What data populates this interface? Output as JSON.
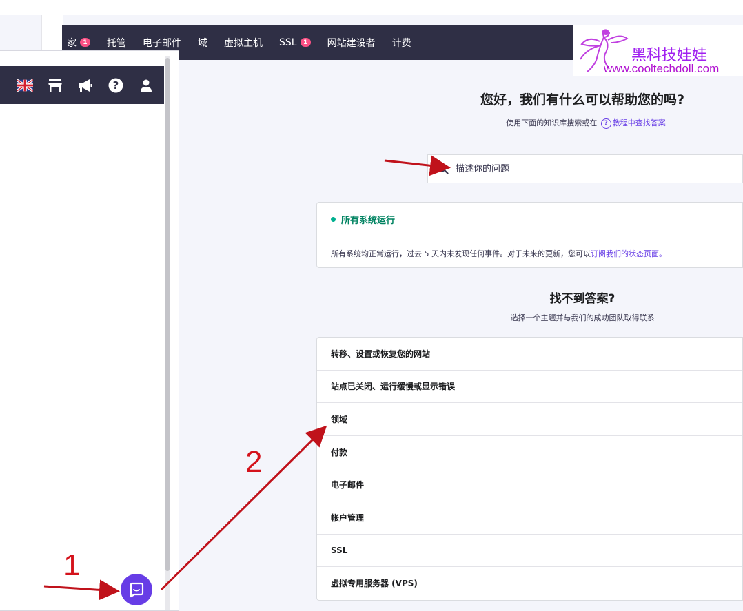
{
  "top_nav": {
    "items": [
      {
        "label": "家",
        "badge": "1"
      },
      {
        "label": "托管",
        "badge": ""
      },
      {
        "label": "电子邮件",
        "badge": ""
      },
      {
        "label": "域",
        "badge": ""
      },
      {
        "label": "虚拟主机",
        "badge": ""
      },
      {
        "label": "SSL",
        "badge": "1"
      },
      {
        "label": "网站建设者",
        "badge": ""
      },
      {
        "label": "计费",
        "badge": ""
      }
    ]
  },
  "watermark": {
    "text_cn": "黑科技娃娃",
    "url": "www.cooltechdoll.com"
  },
  "left_panel": {
    "toolbar_icons": [
      "uk-flag-icon",
      "store-icon",
      "megaphone-icon",
      "help-icon",
      "user-icon"
    ],
    "chat_icon": "chat-icon"
  },
  "help": {
    "title": "您好，我们有什么可以帮助您的吗?",
    "subtitle_prefix": "使用下面的知识库搜索或在",
    "subtitle_link": "教程中查找答案",
    "question_glyph": "?"
  },
  "search": {
    "placeholder": "描述你的问题",
    "value": ""
  },
  "status": {
    "heading": "所有系统运行",
    "body_prefix": "所有系统均正常运行，过去 5 天内未发现任何事件。对于未来的更新，您可以",
    "body_link": "订阅我们的状态页面。"
  },
  "not_found": {
    "title": "找不到答案?",
    "subtitle": "选择一个主题并与我们的成功团队取得联系"
  },
  "topics": [
    "转移、设置或恢复您的网站",
    "站点已关闭、运行缓慢或显示错误",
    "领域",
    "付款",
    "电子邮件",
    "帐户管理",
    "SSL",
    "虚拟专用服务器 (VPS)"
  ],
  "annotations": {
    "step1": "1",
    "step2": "2"
  },
  "colors": {
    "nav_bg": "#2f2f45",
    "accent": "#673de6",
    "badge": "#fc5185",
    "status_green": "#008361",
    "annotation_red": "#d4121b",
    "watermark_purple": "#a020f0"
  }
}
